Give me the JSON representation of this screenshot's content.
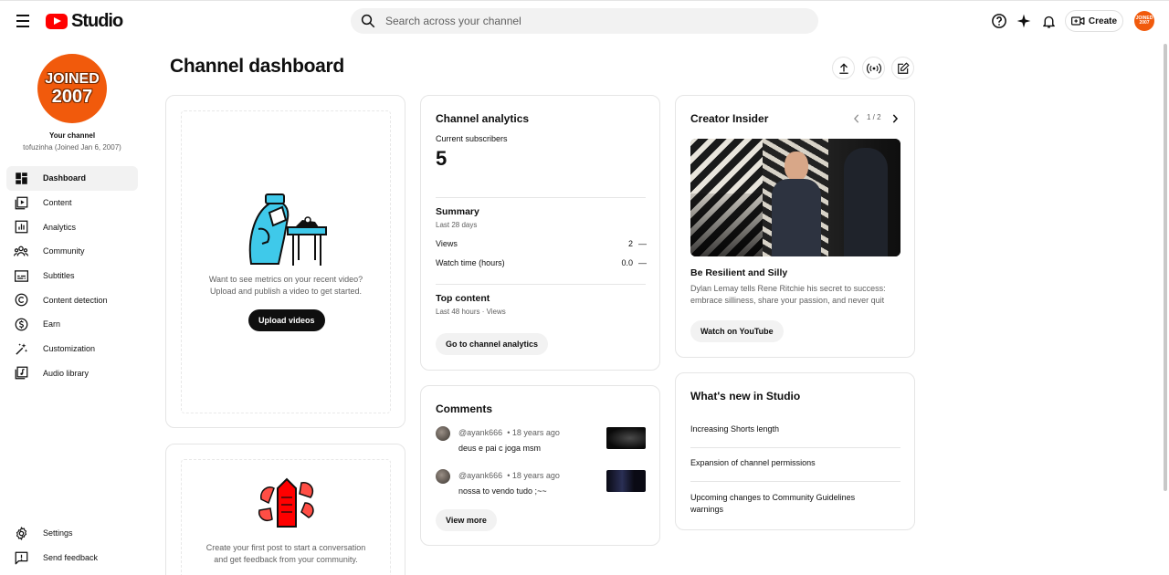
{
  "app": {
    "logo_text": "Studio",
    "search_placeholder": "Search across your channel",
    "create_label": "Create",
    "avatar_line1": "JOINED",
    "avatar_line2": "2007"
  },
  "sidebar": {
    "avatar_line1": "JOINED",
    "avatar_line2": "2007",
    "your_channel": "Your channel",
    "channel_sub": "tofuzinha (Joined Jan 6, 2007)",
    "items": [
      {
        "label": "Dashboard",
        "icon": "dashboard-icon"
      },
      {
        "label": "Content",
        "icon": "content-icon"
      },
      {
        "label": "Analytics",
        "icon": "analytics-icon"
      },
      {
        "label": "Community",
        "icon": "community-icon"
      },
      {
        "label": "Subtitles",
        "icon": "subtitles-icon"
      },
      {
        "label": "Content detection",
        "icon": "copyright-icon"
      },
      {
        "label": "Earn",
        "icon": "dollar-icon"
      },
      {
        "label": "Customization",
        "icon": "magic-wand-icon"
      },
      {
        "label": "Audio library",
        "icon": "audio-library-icon"
      }
    ],
    "bottom_items": [
      {
        "label": "Settings",
        "icon": "gear-icon"
      },
      {
        "label": "Send feedback",
        "icon": "feedback-icon"
      }
    ]
  },
  "main": {
    "title": "Channel dashboard",
    "upload_card": {
      "message_line1": "Want to see metrics on your recent video?",
      "message_line2": "Upload and publish a video to get started.",
      "button": "Upload videos"
    },
    "post_card": {
      "message_line1": "Create your first post to start a conversation",
      "message_line2": "and get feedback from your community."
    },
    "analytics": {
      "title": "Channel analytics",
      "subscribers_label": "Current subscribers",
      "subscribers_value": "5",
      "summary_title": "Summary",
      "summary_period": "Last 28 days",
      "rows": [
        {
          "label": "Views",
          "value": "2",
          "trend": "—"
        },
        {
          "label": "Watch time (hours)",
          "value": "0.0",
          "trend": "—"
        }
      ],
      "top_content_title": "Top content",
      "top_content_period": "Last 48 hours · Views",
      "button": "Go to channel analytics"
    },
    "comments": {
      "title": "Comments",
      "items": [
        {
          "author": "@ayank666",
          "time": "• 18 years ago",
          "text": "deus e pai c joga msm"
        },
        {
          "author": "@ayank666",
          "time": "• 18 years ago",
          "text": "nossa to vendo tudo ;~~"
        }
      ],
      "button": "View more"
    },
    "insider": {
      "title": "Creator Insider",
      "pager": "1 / 2",
      "video_title": "Be Resilient and Silly",
      "description_line1": "Dylan Lemay tells Rene Ritchie his secret to success:",
      "description_line2": "embrace silliness, share your passion, and never quit",
      "button": "Watch on YouTube"
    },
    "whats_new": {
      "title": "What's new in Studio",
      "items": [
        "Increasing Shorts length",
        "Expansion of channel permissions",
        "Upcoming changes to Community Guidelines warnings"
      ]
    }
  }
}
